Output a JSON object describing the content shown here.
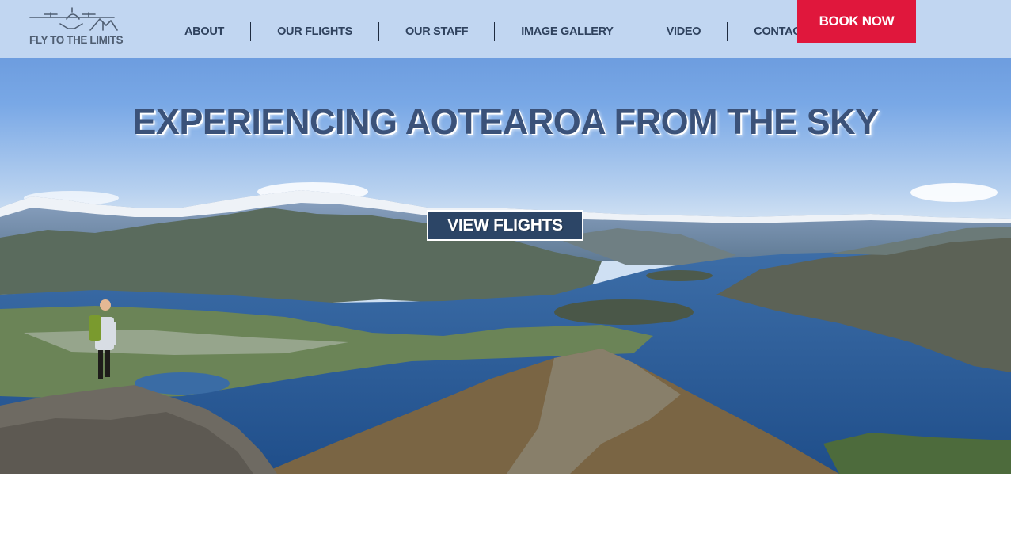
{
  "brand": {
    "logo_text": "FLY TO THE LIMITS",
    "logo_icon": "airplane-mountains-logo"
  },
  "nav": {
    "items": [
      {
        "label": "ABOUT"
      },
      {
        "label": "OUR FLIGHTS"
      },
      {
        "label": "OUR STAFF"
      },
      {
        "label": "IMAGE GALLERY"
      },
      {
        "label": "VIDEO"
      },
      {
        "label": "CONTACT"
      }
    ],
    "book_label": "BOOK NOW"
  },
  "hero": {
    "title": "EXPERIENCING AOTEAROA FROM THE SKY",
    "cta_label": "VIEW FLIGHTS",
    "image": "lake-wanaka-mountain-landscape-with-hiker"
  },
  "colors": {
    "header_bg": "#c1d6f1",
    "nav_text": "#2f425e",
    "book_button": "#e0173c",
    "hero_title": "#3b5279",
    "cta_button": "#2c4566"
  }
}
